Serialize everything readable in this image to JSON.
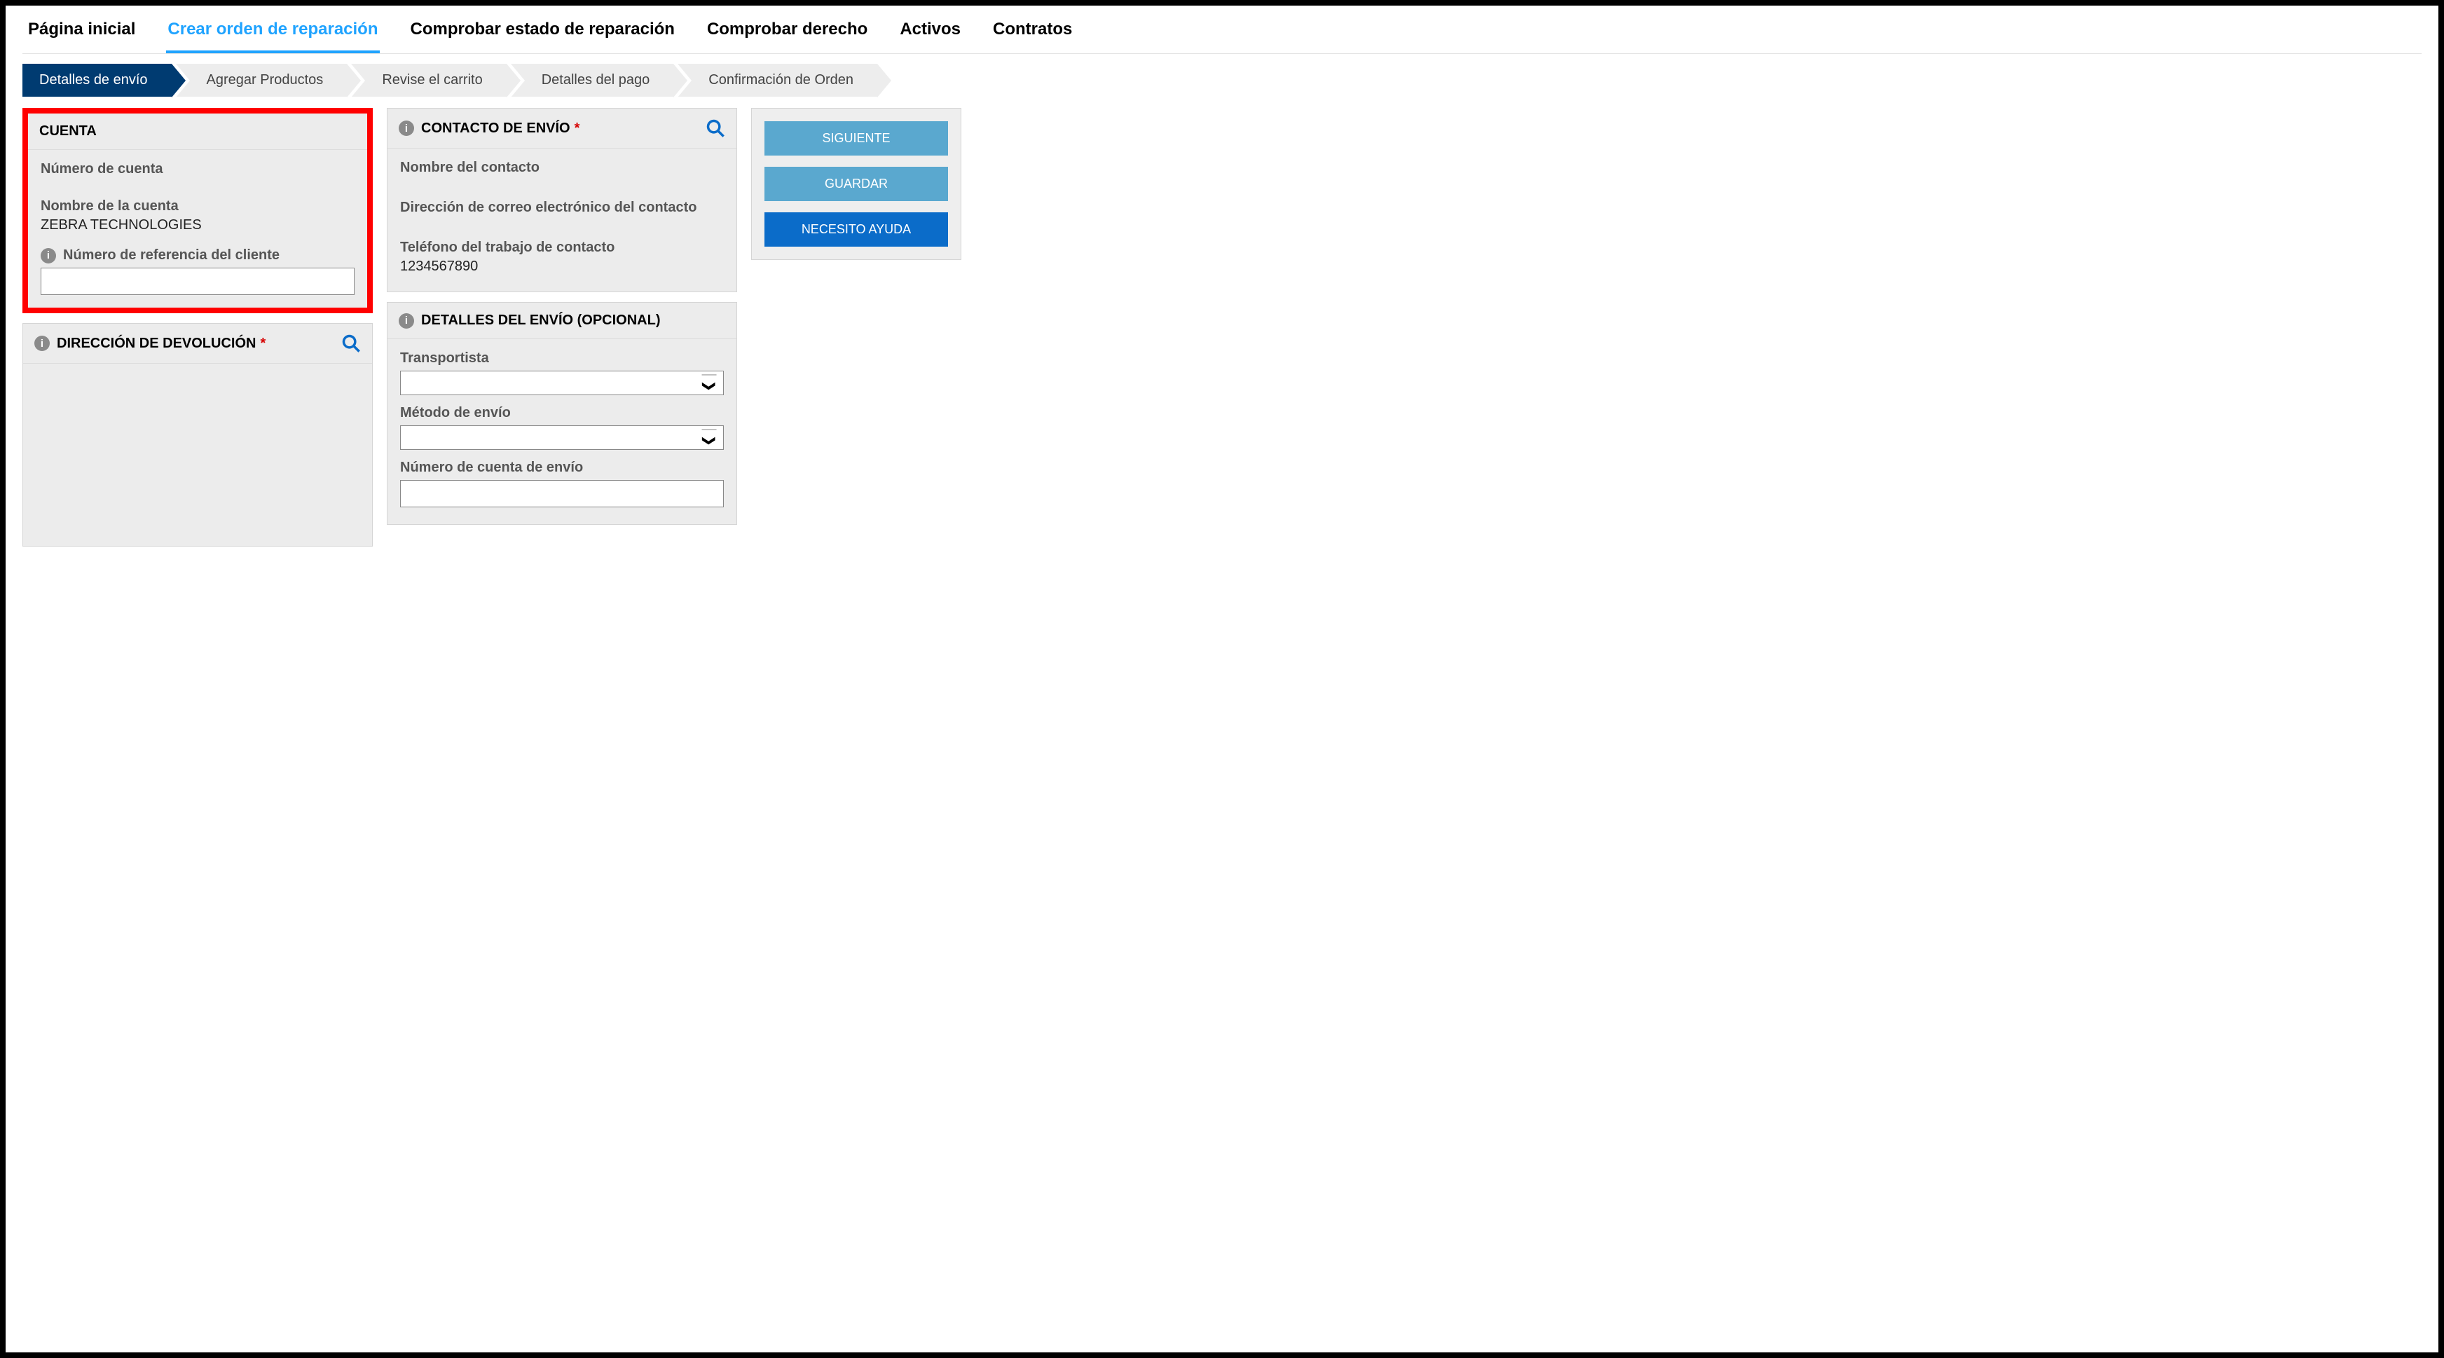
{
  "nav": {
    "home": "Página inicial",
    "create": "Crear orden de reparación",
    "status": "Comprobar estado de reparación",
    "entitlement": "Comprobar derecho",
    "assets": "Activos",
    "contracts": "Contratos"
  },
  "steps": {
    "s1": "Detalles de envío",
    "s2": "Agregar Productos",
    "s3": "Revise el carrito",
    "s4": "Detalles del pago",
    "s5": "Confirmación de Orden"
  },
  "account": {
    "title": "CUENTA",
    "number_label": "Número de cuenta",
    "number_value": "",
    "name_label": "Nombre de la cuenta",
    "name_value": "ZEBRA TECHNOLOGIES",
    "ref_label": "Número de referencia del cliente",
    "ref_value": ""
  },
  "contact": {
    "title": "CONTACTO DE ENVÍO",
    "name_label": "Nombre del contacto",
    "name_value": "",
    "email_label": "Dirección de correo electrónico del contacto",
    "email_value": "",
    "phone_label": "Teléfono del trabajo de contacto",
    "phone_value": "1234567890"
  },
  "return_addr": {
    "title": "DIRECCIÓN DE DEVOLUCIÓN"
  },
  "ship_details": {
    "title": "DETALLES DEL ENVÍO (OPCIONAL)",
    "carrier_label": "Transportista",
    "method_label": "Método de envío",
    "ship_acct_label": "Número de cuenta de envío",
    "ship_acct_value": ""
  },
  "actions": {
    "next": "SIGUIENTE",
    "save": "GUARDAR",
    "help": "NECESITO AYUDA"
  }
}
